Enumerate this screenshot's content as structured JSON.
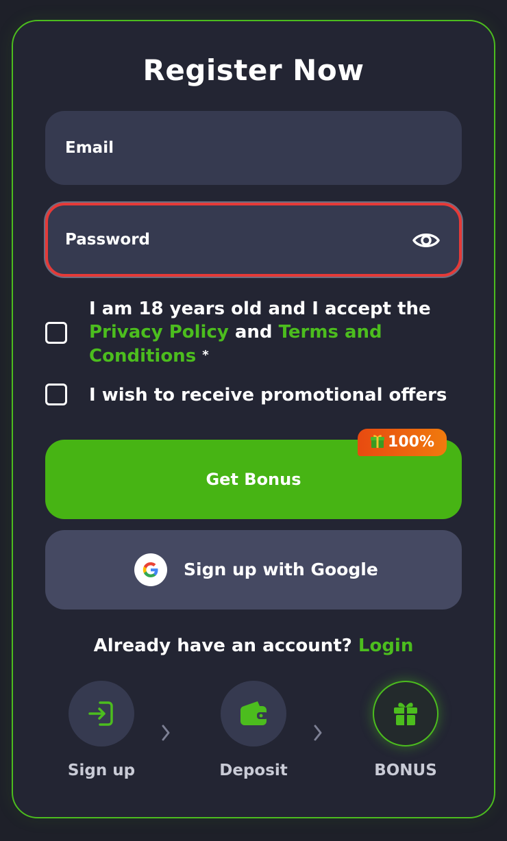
{
  "title": "Register Now",
  "form": {
    "email_label": "Email",
    "password_label": "Password"
  },
  "terms": {
    "line1": "I am 18 years old and I accept the",
    "privacy": "Privacy Policy",
    "and": "and",
    "terms_link": "Terms and",
    "conditions": "Conditions",
    "required": "*"
  },
  "promo_label": "I wish to receive promotional offers",
  "buttons": {
    "bonus_label": "Get Bonus",
    "badge": "100%",
    "google_label": "Sign up with Google"
  },
  "login": {
    "prompt": "Already have an account?",
    "link": "Login"
  },
  "steps": [
    {
      "label": "Sign up",
      "icon": "sign-in-icon"
    },
    {
      "label": "Deposit",
      "icon": "wallet-icon"
    },
    {
      "label": "BONUS",
      "icon": "gift-icon"
    }
  ],
  "colors": {
    "accent": "#4cbd1e",
    "error": "#e53a38",
    "badge": "#ed5e0f",
    "background": "#232533"
  }
}
